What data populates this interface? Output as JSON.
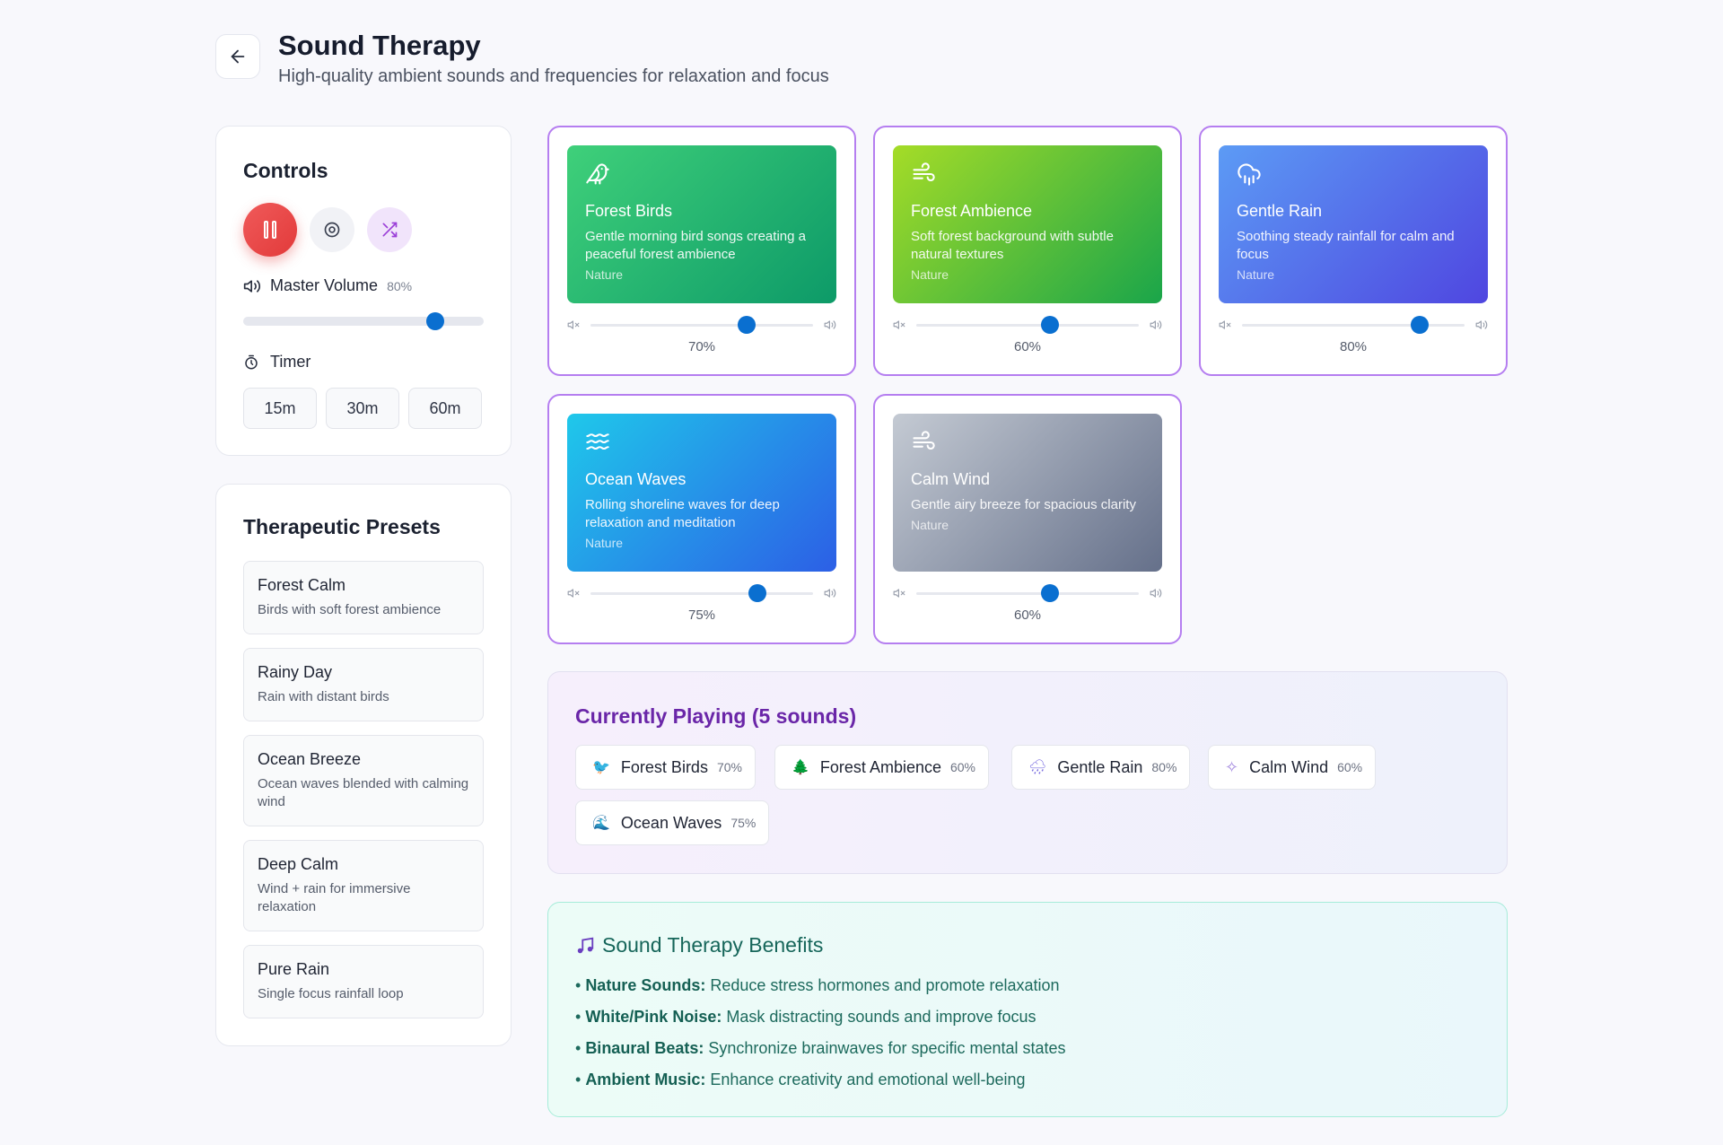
{
  "header": {
    "title": "Sound Therapy",
    "subtitle": "High-quality ambient sounds and frequencies for relaxation and focus"
  },
  "controls": {
    "title": "Controls",
    "master_volume_label": "Master Volume",
    "master_volume_pct": "80%",
    "master_volume_value": 0.8,
    "timer_label": "Timer",
    "timer_options": [
      "15m",
      "30m",
      "60m"
    ]
  },
  "presets": {
    "title": "Therapeutic Presets",
    "items": [
      {
        "name": "Forest Calm",
        "desc": "Birds with soft forest ambience"
      },
      {
        "name": "Rainy Day",
        "desc": "Rain with distant birds"
      },
      {
        "name": "Ocean Breeze",
        "desc": "Ocean waves blended with calming wind"
      },
      {
        "name": "Deep Calm",
        "desc": "Wind + rain for immersive relaxation"
      },
      {
        "name": "Pure Rain",
        "desc": "Single focus rainfall loop"
      }
    ]
  },
  "sounds": [
    {
      "name": "Forest Birds",
      "desc": "Gentle morning bird songs creating a peaceful forest ambience",
      "category": "Nature",
      "pct": "70%",
      "value": 0.7,
      "icon": "bird-icon",
      "gradient": [
        "#3fd07a",
        "#0d9a68"
      ]
    },
    {
      "name": "Forest Ambience",
      "desc": "Soft forest background with subtle natural textures",
      "category": "Nature",
      "pct": "60%",
      "value": 0.6,
      "icon": "wind-icon",
      "gradient": [
        "#a5dc27",
        "#1aa54a"
      ]
    },
    {
      "name": "Gentle Rain",
      "desc": "Soothing steady rainfall for calm and focus",
      "category": "Nature",
      "pct": "80%",
      "value": 0.8,
      "icon": "cloud-rain-icon",
      "gradient": [
        "#5c9bf5",
        "#4f46e0"
      ]
    },
    {
      "name": "Ocean Waves",
      "desc": "Rolling shoreline waves for deep relaxation and meditation",
      "category": "Nature",
      "pct": "75%",
      "value": 0.75,
      "icon": "waves-icon",
      "gradient": [
        "#1fc8ea",
        "#2c5fe6"
      ]
    },
    {
      "name": "Calm Wind",
      "desc": "Gentle airy breeze for spacious clarity",
      "category": "Nature",
      "pct": "60%",
      "value": 0.6,
      "icon": "wind-icon",
      "gradient": [
        "#c4cad3",
        "#65708a"
      ]
    }
  ],
  "playing": {
    "title": "Currently Playing (5 sounds)",
    "chips": [
      {
        "name": "Forest Birds",
        "pct": "70%",
        "emoji": "🐦"
      },
      {
        "name": "Forest Ambience",
        "pct": "60%",
        "emoji": "🌲"
      },
      {
        "name": "Gentle Rain",
        "pct": "80%",
        "emoji": "🌧"
      },
      {
        "name": "Calm Wind",
        "pct": "60%",
        "emoji": "✧"
      },
      {
        "name": "Ocean Waves",
        "pct": "75%",
        "emoji": "🌊"
      }
    ]
  },
  "benefits": {
    "title": "Sound Therapy Benefits",
    "items": [
      {
        "label": "Nature Sounds:",
        "text": "Reduce stress hormones and promote relaxation"
      },
      {
        "label": "White/Pink Noise:",
        "text": "Mask distracting sounds and improve focus"
      },
      {
        "label": "Binaural Beats:",
        "text": "Synchronize brainwaves for specific mental states"
      },
      {
        "label": "Ambient Music:",
        "text": "Enhance creativity and emotional well-being"
      }
    ]
  }
}
